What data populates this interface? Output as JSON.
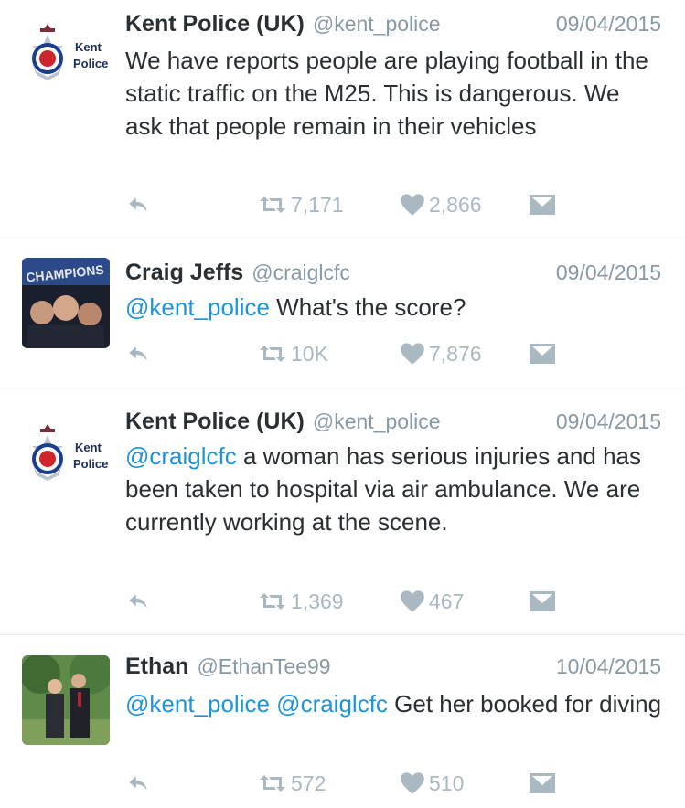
{
  "colors": {
    "name": "#292f33",
    "meta": "#8899a6",
    "mention": "#1b95e0",
    "action": "#aab8c2",
    "divider": "#e1e8ed"
  },
  "icons": {
    "reply": "reply-icon",
    "retweet": "retweet-icon",
    "like": "heart-icon",
    "message": "direct-message-icon"
  },
  "tweets": [
    {
      "name": "Kent Police (UK)",
      "handle": "@kent_police",
      "date": "09/04/2015",
      "avatar_text": [
        "Kent",
        "Police"
      ],
      "text": "We have reports people are playing football in the static traffic on the M25. This is dangerous. We ask that people remain in their vehicles",
      "retweets": "7,171",
      "likes": "2,866"
    },
    {
      "name": "Craig Jeffs",
      "handle": "@craiglcfc",
      "date": "09/04/2015",
      "avatar_banner": "CHAMPIONS",
      "mention": "@kent_police",
      "text": " What's the score?",
      "retweets": "10K",
      "likes": "7,876"
    },
    {
      "name": "Kent Police (UK)",
      "handle": "@kent_police",
      "date": "09/04/2015",
      "avatar_text": [
        "Kent",
        "Police"
      ],
      "mention": "@craiglcfc",
      "text": " a woman has serious injuries and has been taken to hospital via air ambulance. We are currently working at the scene.",
      "retweets": "1,369",
      "likes": "467"
    },
    {
      "name": "Ethan",
      "handle": "@EthanTee99",
      "date": "10/04/2015",
      "mention": "@kent_police",
      "mention2": "@craiglcfc",
      "text": " Get her booked for diving",
      "retweets": "572",
      "likes": "510"
    }
  ]
}
